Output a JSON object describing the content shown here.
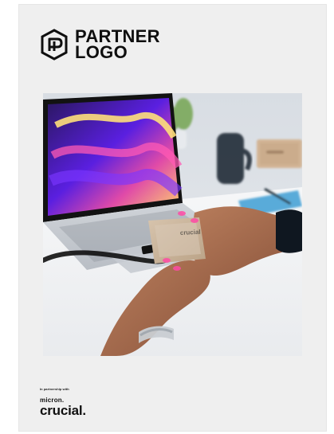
{
  "header": {
    "logo_icon": "hexagon-monogram-icon",
    "logo_line1": "PARTNER",
    "logo_line2": "LOGO"
  },
  "hero": {
    "image": "photo of hands holding a Crucial portable SSD connected to a laptop"
  },
  "footer": {
    "partnership_text": "In partnership with",
    "brand_top": "micron.",
    "brand_main": "crucial."
  },
  "colors": {
    "page_bg": "#efefef",
    "text": "#0f0f0f"
  }
}
